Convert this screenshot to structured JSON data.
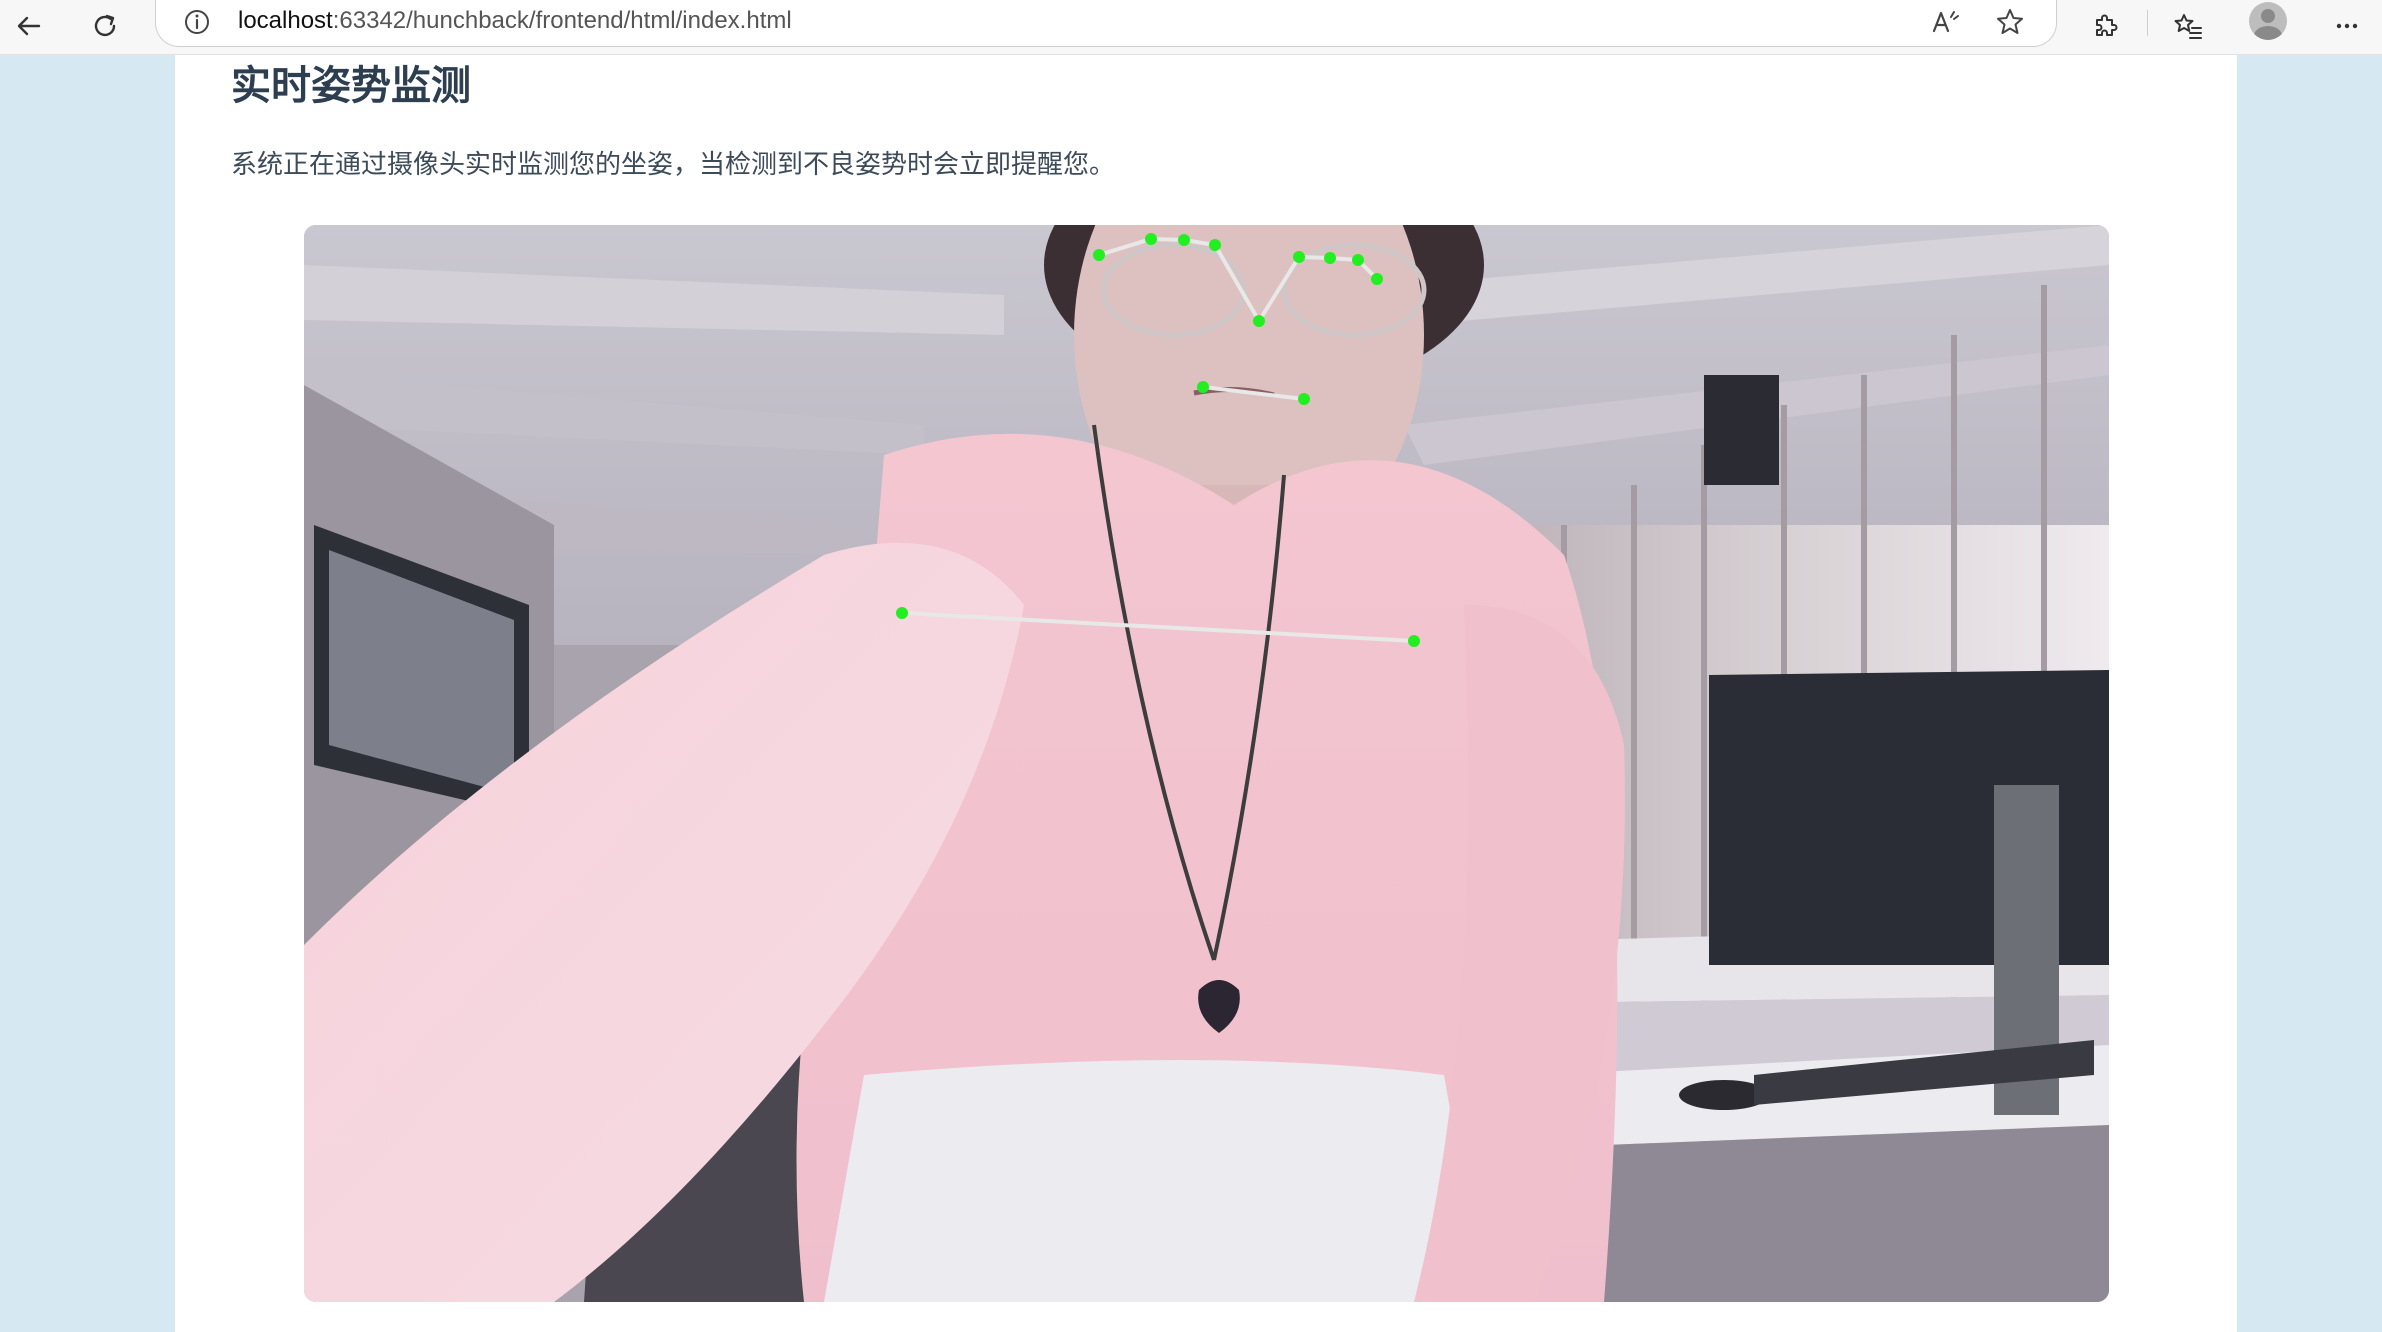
{
  "browser": {
    "url_host": "localhost",
    "url_rest": ":63342/hunchback/frontend/html/index.html",
    "icons": {
      "back": "back-arrow-icon",
      "reload": "reload-icon",
      "info": "info-icon",
      "read_aloud": "read-aloud-icon",
      "favorite": "star-icon",
      "extensions": "extensions-icon",
      "favorites_list": "favorites-list-icon",
      "profile": "profile-avatar",
      "more": "more-icon"
    }
  },
  "page": {
    "title": "实时姿势监测",
    "description": "系统正在通过摄像头实时监测您的坐姿，当检测到不良姿势时会立即提醒您。"
  },
  "video": {
    "overlay_color": "#22ee22",
    "line_color": "#e8e8e8"
  }
}
